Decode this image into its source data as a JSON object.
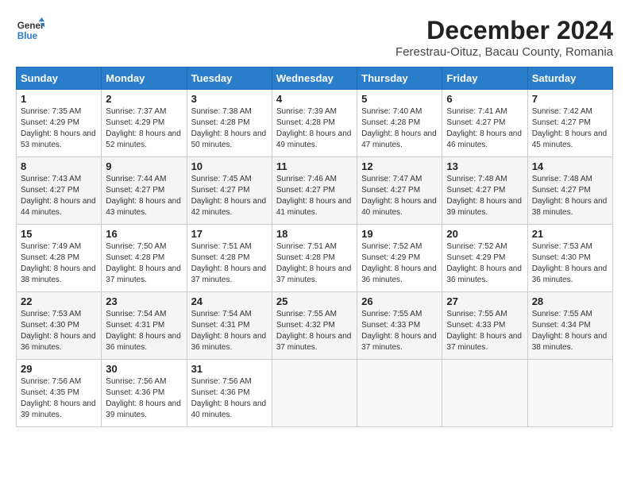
{
  "logo": {
    "line1": "General",
    "line2": "Blue"
  },
  "title": "December 2024",
  "subtitle": "Ferestrau-Oituz, Bacau County, Romania",
  "weekdays": [
    "Sunday",
    "Monday",
    "Tuesday",
    "Wednesday",
    "Thursday",
    "Friday",
    "Saturday"
  ],
  "weeks": [
    [
      {
        "day": "1",
        "sunrise": "7:35 AM",
        "sunset": "4:29 PM",
        "daylight": "8 hours and 53 minutes."
      },
      {
        "day": "2",
        "sunrise": "7:37 AM",
        "sunset": "4:29 PM",
        "daylight": "8 hours and 52 minutes."
      },
      {
        "day": "3",
        "sunrise": "7:38 AM",
        "sunset": "4:28 PM",
        "daylight": "8 hours and 50 minutes."
      },
      {
        "day": "4",
        "sunrise": "7:39 AM",
        "sunset": "4:28 PM",
        "daylight": "8 hours and 49 minutes."
      },
      {
        "day": "5",
        "sunrise": "7:40 AM",
        "sunset": "4:28 PM",
        "daylight": "8 hours and 47 minutes."
      },
      {
        "day": "6",
        "sunrise": "7:41 AM",
        "sunset": "4:27 PM",
        "daylight": "8 hours and 46 minutes."
      },
      {
        "day": "7",
        "sunrise": "7:42 AM",
        "sunset": "4:27 PM",
        "daylight": "8 hours and 45 minutes."
      }
    ],
    [
      {
        "day": "8",
        "sunrise": "7:43 AM",
        "sunset": "4:27 PM",
        "daylight": "8 hours and 44 minutes."
      },
      {
        "day": "9",
        "sunrise": "7:44 AM",
        "sunset": "4:27 PM",
        "daylight": "8 hours and 43 minutes."
      },
      {
        "day": "10",
        "sunrise": "7:45 AM",
        "sunset": "4:27 PM",
        "daylight": "8 hours and 42 minutes."
      },
      {
        "day": "11",
        "sunrise": "7:46 AM",
        "sunset": "4:27 PM",
        "daylight": "8 hours and 41 minutes."
      },
      {
        "day": "12",
        "sunrise": "7:47 AM",
        "sunset": "4:27 PM",
        "daylight": "8 hours and 40 minutes."
      },
      {
        "day": "13",
        "sunrise": "7:48 AM",
        "sunset": "4:27 PM",
        "daylight": "8 hours and 39 minutes."
      },
      {
        "day": "14",
        "sunrise": "7:48 AM",
        "sunset": "4:27 PM",
        "daylight": "8 hours and 38 minutes."
      }
    ],
    [
      {
        "day": "15",
        "sunrise": "7:49 AM",
        "sunset": "4:28 PM",
        "daylight": "8 hours and 38 minutes."
      },
      {
        "day": "16",
        "sunrise": "7:50 AM",
        "sunset": "4:28 PM",
        "daylight": "8 hours and 37 minutes."
      },
      {
        "day": "17",
        "sunrise": "7:51 AM",
        "sunset": "4:28 PM",
        "daylight": "8 hours and 37 minutes."
      },
      {
        "day": "18",
        "sunrise": "7:51 AM",
        "sunset": "4:28 PM",
        "daylight": "8 hours and 37 minutes."
      },
      {
        "day": "19",
        "sunrise": "7:52 AM",
        "sunset": "4:29 PM",
        "daylight": "8 hours and 36 minutes."
      },
      {
        "day": "20",
        "sunrise": "7:52 AM",
        "sunset": "4:29 PM",
        "daylight": "8 hours and 36 minutes."
      },
      {
        "day": "21",
        "sunrise": "7:53 AM",
        "sunset": "4:30 PM",
        "daylight": "8 hours and 36 minutes."
      }
    ],
    [
      {
        "day": "22",
        "sunrise": "7:53 AM",
        "sunset": "4:30 PM",
        "daylight": "8 hours and 36 minutes."
      },
      {
        "day": "23",
        "sunrise": "7:54 AM",
        "sunset": "4:31 PM",
        "daylight": "8 hours and 36 minutes."
      },
      {
        "day": "24",
        "sunrise": "7:54 AM",
        "sunset": "4:31 PM",
        "daylight": "8 hours and 36 minutes."
      },
      {
        "day": "25",
        "sunrise": "7:55 AM",
        "sunset": "4:32 PM",
        "daylight": "8 hours and 37 minutes."
      },
      {
        "day": "26",
        "sunrise": "7:55 AM",
        "sunset": "4:33 PM",
        "daylight": "8 hours and 37 minutes."
      },
      {
        "day": "27",
        "sunrise": "7:55 AM",
        "sunset": "4:33 PM",
        "daylight": "8 hours and 37 minutes."
      },
      {
        "day": "28",
        "sunrise": "7:55 AM",
        "sunset": "4:34 PM",
        "daylight": "8 hours and 38 minutes."
      }
    ],
    [
      {
        "day": "29",
        "sunrise": "7:56 AM",
        "sunset": "4:35 PM",
        "daylight": "8 hours and 39 minutes."
      },
      {
        "day": "30",
        "sunrise": "7:56 AM",
        "sunset": "4:36 PM",
        "daylight": "8 hours and 39 minutes."
      },
      {
        "day": "31",
        "sunrise": "7:56 AM",
        "sunset": "4:36 PM",
        "daylight": "8 hours and 40 minutes."
      },
      null,
      null,
      null,
      null
    ]
  ]
}
